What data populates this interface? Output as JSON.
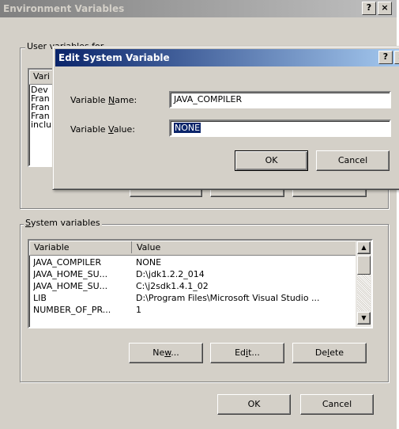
{
  "outer": {
    "title": "Environment Variables",
    "help_glyph": "?",
    "close_glyph": "×",
    "user_group_label": "User variables for ...",
    "user_list": {
      "header_partial": "Vari",
      "rows_partial": [
        "Dev",
        "Fran",
        "Fran",
        "Fran",
        "inclu"
      ]
    },
    "system_group_label": "System variables",
    "system_list": {
      "columns": [
        "Variable",
        "Value"
      ],
      "rows": [
        {
          "variable": "JAVA_COMPILER",
          "value": "NONE"
        },
        {
          "variable": "JAVA_HOME_SU...",
          "value": "D:\\jdk1.2.2_014"
        },
        {
          "variable": "JAVA_HOME_SU...",
          "value": "C:\\j2sdk1.4.1_02"
        },
        {
          "variable": "LIB",
          "value": "D:\\Program Files\\Microsoft Visual Studio ..."
        },
        {
          "variable": "NUMBER_OF_PR...",
          "value": "1"
        }
      ]
    },
    "buttons": {
      "new": "New...",
      "edit": "Edit...",
      "delete": "Delete",
      "ok": "OK",
      "cancel": "Cancel"
    }
  },
  "edit_dialog": {
    "title": "Edit System Variable",
    "help_glyph": "?",
    "close_glyph": "×",
    "name_label": "Variable Name:",
    "name_value": "JAVA_COMPILER",
    "value_label": "Variable Value:",
    "value_value": "NONE",
    "ok": "OK",
    "cancel": "Cancel"
  },
  "colors": {
    "face": "#d4d0c8",
    "active_title": "#0a246a",
    "inactive_title": "#808080",
    "selection": "#0a246a"
  }
}
